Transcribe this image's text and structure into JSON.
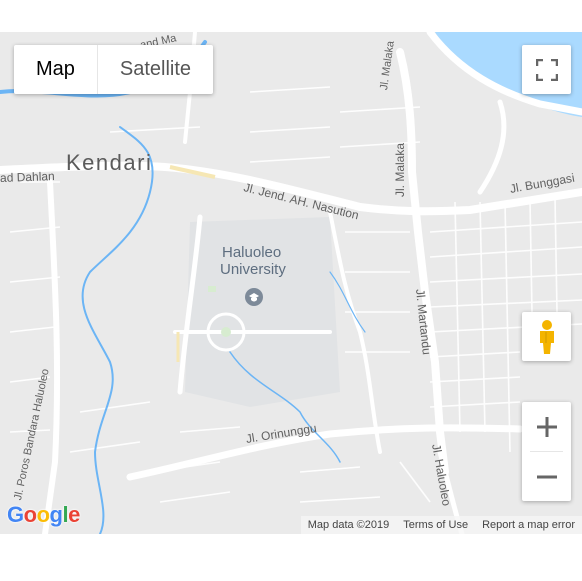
{
  "map_type": {
    "map_label": "Map",
    "satellite_label": "Satellite",
    "selected": "Map"
  },
  "places": {
    "city": "Kendari",
    "university_line1": "Haluoleo",
    "university_line2": "University"
  },
  "roads": {
    "ahmad_dahlan": "ad Dahlan",
    "ahmad_top": "and Ma",
    "nasution": "Jl. Jend. AH. Nasution",
    "bunggasi": "Jl. Bunggasi",
    "malaka_top": "Jl. Malaka",
    "malaka": "Jl. Malaka",
    "martandu": "Jl. Martandu",
    "orinunggu": "Jl. Orinunggu",
    "haluoleo": "Jl. Haluoleo",
    "poros": "Jl. Poros Bandara Haluoleo"
  },
  "footer": {
    "map_data": "Map data ©2019",
    "terms": "Terms of Use",
    "report": "Report a map error"
  },
  "logo": {
    "g1": "G",
    "o1": "o",
    "o2": "o",
    "g2": "g",
    "l": "l",
    "e": "e"
  },
  "colors": {
    "land": "#eaeaea",
    "road": "#ffffff",
    "water": "#aadaff",
    "river": "#6cb5f5",
    "park": "#d7ecd0",
    "campus": "#e1e3e5",
    "accent": "#1a73e8",
    "pegman": "#f4b400"
  },
  "icons": {
    "fullscreen": "fullscreen-icon",
    "pegman": "pegman-icon",
    "zoom_in": "zoom-in-icon",
    "zoom_out": "zoom-out-icon",
    "university": "graduation-cap-icon"
  }
}
